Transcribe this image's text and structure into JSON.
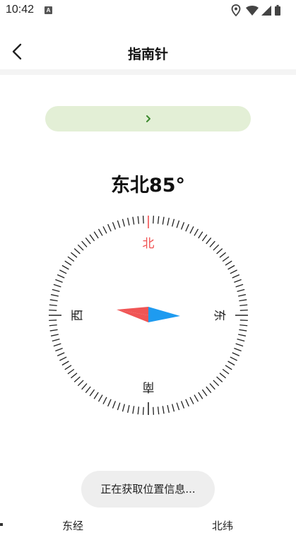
{
  "status_bar": {
    "time": "10:42",
    "notification_badge": "A",
    "icons": [
      "location-icon",
      "wifi-icon",
      "signal-icon",
      "battery-icon"
    ]
  },
  "header": {
    "title": "指南针",
    "back_icon": "chevron-left-icon"
  },
  "banner": {
    "chevron": "›",
    "color": "#e3efd6"
  },
  "compass": {
    "heading_text": "东北85°",
    "directions": {
      "north": "北",
      "east": "东",
      "south": "南",
      "west": "西"
    },
    "north_color": "#f05050",
    "needle_colors": {
      "north": "#f05555",
      "south": "#1e9bf0"
    },
    "needle_bearing_deg": 85
  },
  "toast": {
    "text": "正在获取位置信息..."
  },
  "footer": {
    "longitude_label": "东经",
    "latitude_label": "北纬"
  }
}
